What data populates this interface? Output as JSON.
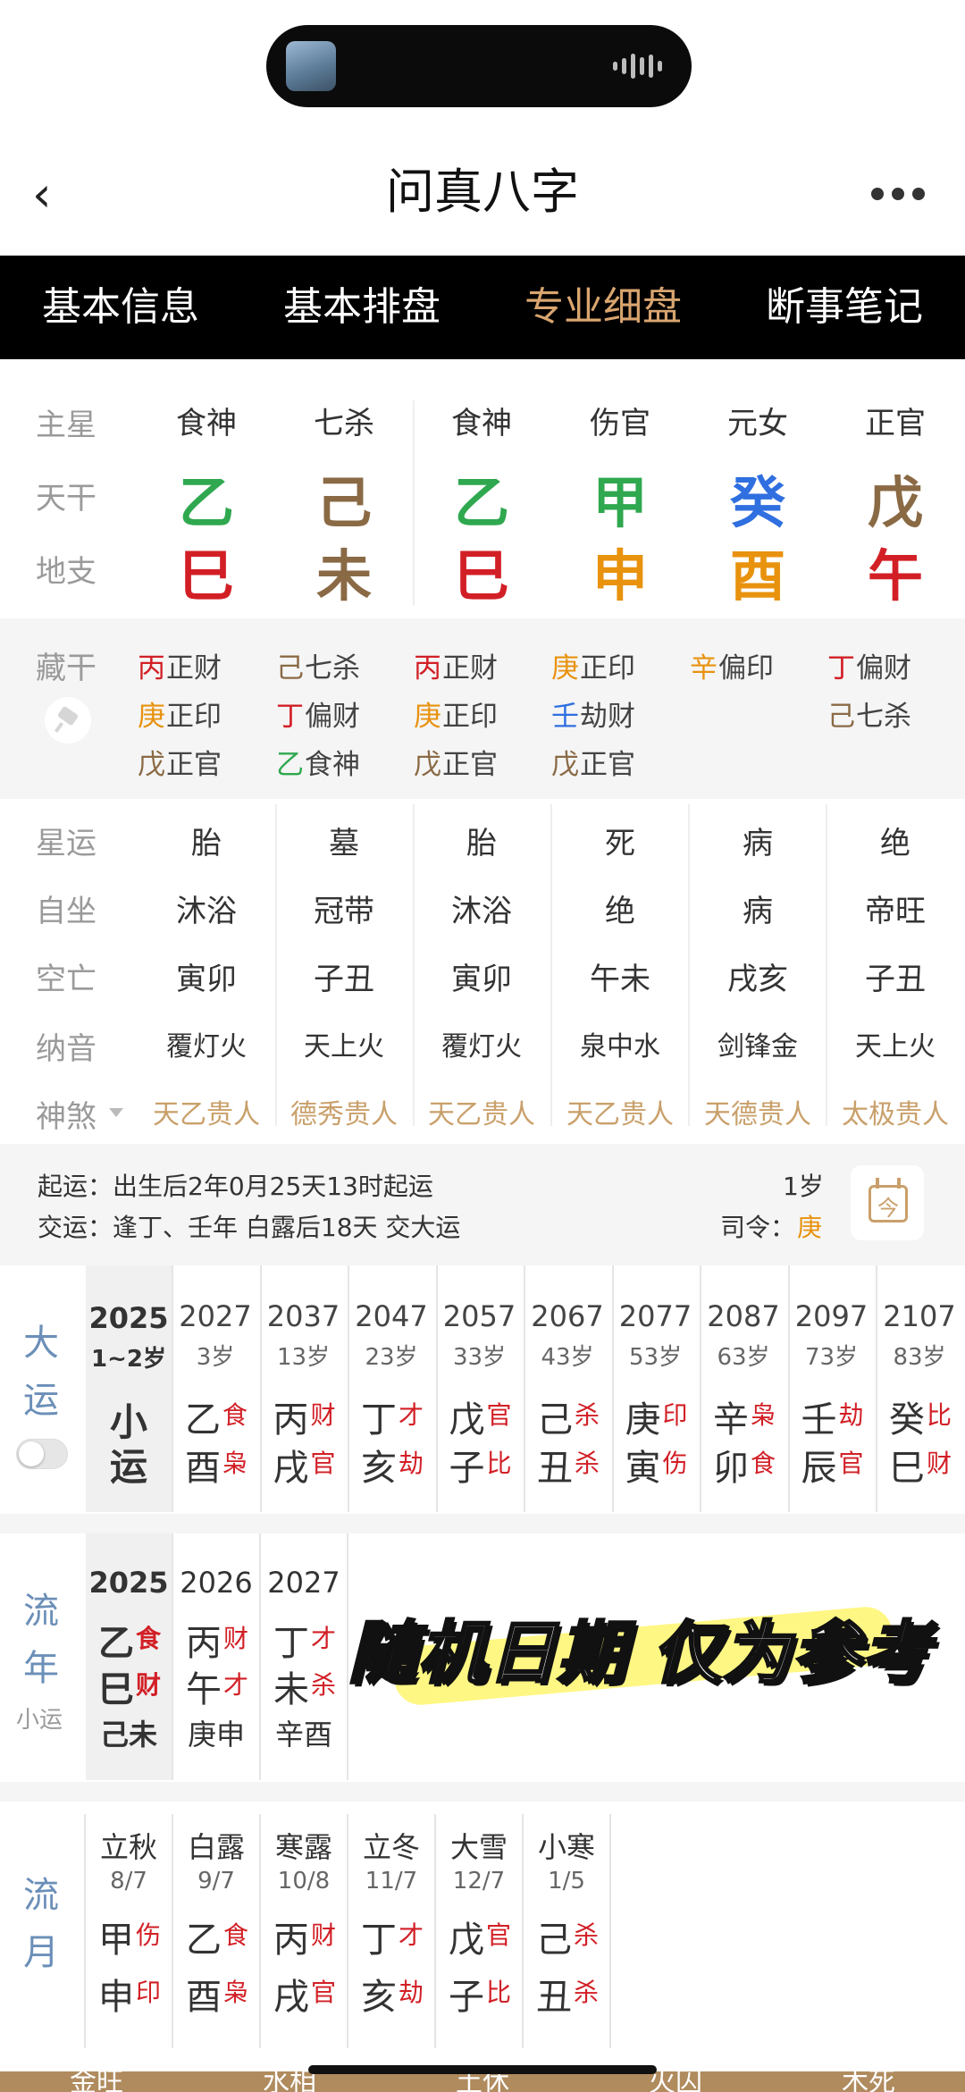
{
  "app": {
    "title": "问真八字"
  },
  "tabs": [
    "基本信息",
    "基本排盘",
    "专业细盘",
    "断事笔记"
  ],
  "pillars": {
    "labels": {
      "main_star": "主星",
      "tiangan": "天干",
      "dizhi": "地支"
    },
    "main_star": [
      "食神",
      "七杀",
      "食神",
      "伤官",
      "元女",
      "正官"
    ],
    "tiangan": [
      "乙",
      "己",
      "乙",
      "甲",
      "癸",
      "戊"
    ],
    "dizhi": [
      "巳",
      "未",
      "巳",
      "申",
      "酉",
      "午"
    ],
    "colors": {
      "wood": "#2fa84f",
      "earth": "#8a6a45",
      "fire": "#d21f26",
      "metal": "#e8920e",
      "water": "#2f6fe0"
    }
  },
  "canggan": {
    "label": "藏干",
    "columns": [
      [
        [
          "丙",
          "正财"
        ],
        [
          "庚",
          "正印"
        ],
        [
          "戊",
          "正官"
        ]
      ],
      [
        [
          "己",
          "七杀"
        ],
        [
          "丁",
          "偏财"
        ],
        [
          "乙",
          "食神"
        ]
      ],
      [
        [
          "丙",
          "正财"
        ],
        [
          "庚",
          "正印"
        ],
        [
          "戊",
          "正官"
        ]
      ],
      [
        [
          "庚",
          "正印"
        ],
        [
          "壬",
          "劫财"
        ],
        [
          "戊",
          "正官"
        ]
      ],
      [
        [
          "辛",
          "偏印"
        ]
      ],
      [
        [
          "丁",
          "偏财"
        ],
        [
          "己",
          "七杀"
        ]
      ]
    ]
  },
  "details": {
    "xingyun": {
      "label": "星运",
      "values": [
        "胎",
        "墓",
        "胎",
        "死",
        "病",
        "绝"
      ]
    },
    "zizuo": {
      "label": "自坐",
      "values": [
        "沐浴",
        "冠带",
        "沐浴",
        "绝",
        "病",
        "帝旺"
      ]
    },
    "kongwang": {
      "label": "空亡",
      "values": [
        "寅卯",
        "子丑",
        "寅卯",
        "午未",
        "戌亥",
        "子丑"
      ]
    },
    "nayin": {
      "label": "纳音",
      "values": [
        "覆灯火",
        "天上火",
        "覆灯火",
        "泉中水",
        "剑锋金",
        "天上火"
      ]
    },
    "shensha": {
      "label": "神煞",
      "values": [
        "天乙贵人",
        "德秀贵人",
        "天乙贵人",
        "天乙贵人",
        "天德贵人",
        "太极贵人"
      ]
    }
  },
  "qiyun": {
    "line1": "起运：出生后2年0月25天13时起运",
    "line2": "交运：逢丁、壬年 白露后18天 交大运",
    "age": "1岁",
    "siling_label": "司令：",
    "siling_value": "庚",
    "calendar_icon_char": "今"
  },
  "dayun": {
    "label": [
      "大",
      "运"
    ],
    "first": {
      "year": "2025",
      "age": "1~2岁",
      "text": [
        "小",
        "运"
      ]
    },
    "columns": [
      {
        "year": "2027",
        "age": "3岁",
        "gan": "乙",
        "gan_god": "食",
        "zhi": "酉",
        "zhi_god": "枭"
      },
      {
        "year": "2037",
        "age": "13岁",
        "gan": "丙",
        "gan_god": "财",
        "zhi": "戌",
        "zhi_god": "官"
      },
      {
        "year": "2047",
        "age": "23岁",
        "gan": "丁",
        "gan_god": "才",
        "zhi": "亥",
        "zhi_god": "劫"
      },
      {
        "year": "2057",
        "age": "33岁",
        "gan": "戊",
        "gan_god": "官",
        "zhi": "子",
        "zhi_god": "比"
      },
      {
        "year": "2067",
        "age": "43岁",
        "gan": "己",
        "gan_god": "杀",
        "zhi": "丑",
        "zhi_god": "杀"
      },
      {
        "year": "2077",
        "age": "53岁",
        "gan": "庚",
        "gan_god": "印",
        "zhi": "寅",
        "zhi_god": "伤"
      },
      {
        "year": "2087",
        "age": "63岁",
        "gan": "辛",
        "gan_god": "枭",
        "zhi": "卯",
        "zhi_god": "食"
      },
      {
        "year": "2097",
        "age": "73岁",
        "gan": "壬",
        "gan_god": "劫",
        "zhi": "辰",
        "zhi_god": "官"
      },
      {
        "year": "2107",
        "age": "83岁",
        "gan": "癸",
        "gan_god": "比",
        "zhi": "巳",
        "zhi_god": "财"
      }
    ]
  },
  "liunian": {
    "label": [
      "流",
      "年"
    ],
    "sub_label": "小运",
    "columns": [
      {
        "year": "2025",
        "gan": "乙",
        "gan_god": "食",
        "zhi": "巳",
        "zhi_god": "财",
        "xiaoyun": "己未"
      },
      {
        "year": "2026",
        "gan": "丙",
        "gan_god": "财",
        "zhi": "午",
        "zhi_god": "才",
        "xiaoyun": "庚申"
      },
      {
        "year": "2027",
        "gan": "丁",
        "gan_god": "才",
        "zhi": "未",
        "zhi_god": "杀",
        "xiaoyun": "辛酉"
      }
    ],
    "watermark": "随机日期 仅为参考"
  },
  "liuyue": {
    "label": [
      "流",
      "月"
    ],
    "columns": [
      {
        "term": "立秋",
        "date": "8/7",
        "gan": "甲",
        "gan_god": "伤",
        "zhi": "申",
        "zhi_god": "印"
      },
      {
        "term": "白露",
        "date": "9/7",
        "gan": "乙",
        "gan_god": "食",
        "zhi": "酉",
        "zhi_god": "枭"
      },
      {
        "term": "寒露",
        "date": "10/8",
        "gan": "丙",
        "gan_god": "财",
        "zhi": "戌",
        "zhi_god": "官"
      },
      {
        "term": "立冬",
        "date": "11/7",
        "gan": "丁",
        "gan_god": "才",
        "zhi": "亥",
        "zhi_god": "劫"
      },
      {
        "term": "大雪",
        "date": "12/7",
        "gan": "戊",
        "gan_god": "官",
        "zhi": "子",
        "zhi_god": "比"
      },
      {
        "term": "小寒",
        "date": "1/5",
        "gan": "己",
        "gan_god": "杀",
        "zhi": "丑",
        "zhi_god": "杀"
      }
    ]
  },
  "bottom_bar": [
    "金旺",
    "水相",
    "土休",
    "火囚",
    "木死"
  ]
}
